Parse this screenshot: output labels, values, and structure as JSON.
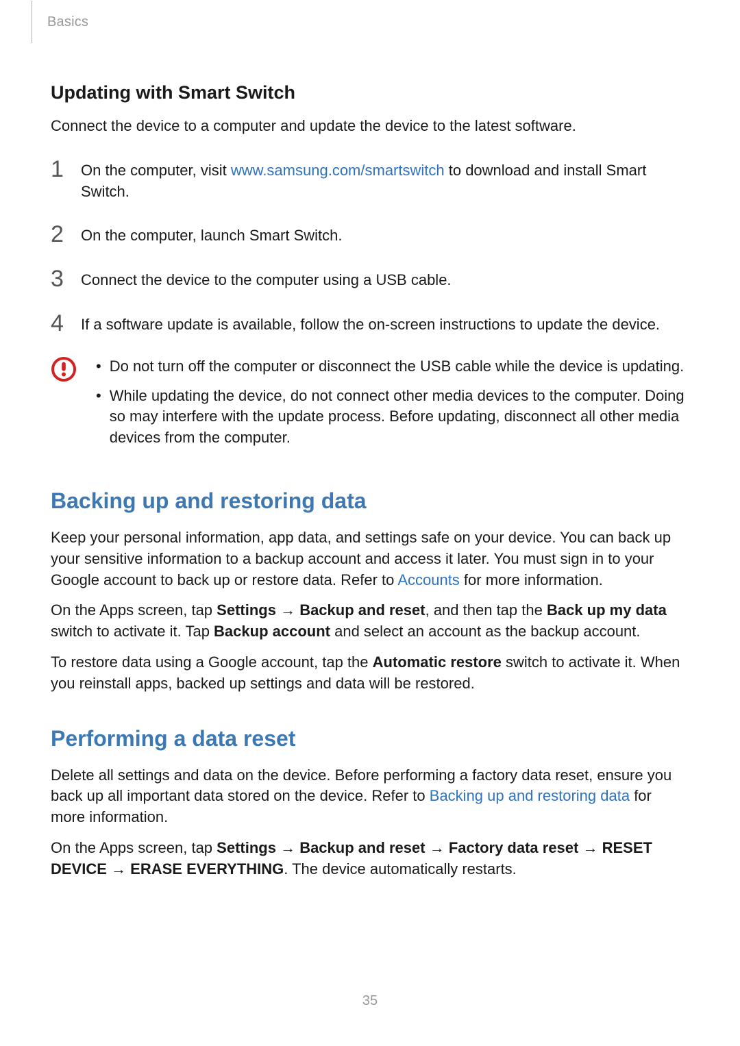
{
  "header": {
    "crumb": "Basics"
  },
  "section_update": {
    "title": "Updating with Smart Switch",
    "intro": "Connect the device to a computer and update the device to the latest software.",
    "steps": {
      "s1": {
        "num": "1",
        "pre": "On the computer, visit ",
        "link": "www.samsung.com/smartswitch",
        "post": " to download and install Smart Switch."
      },
      "s2": {
        "num": "2",
        "text": "On the computer, launch Smart Switch."
      },
      "s3": {
        "num": "3",
        "text": "Connect the device to the computer using a USB cable."
      },
      "s4": {
        "num": "4",
        "text": "If a software update is available, follow the on-screen instructions to update the device."
      }
    },
    "caution": {
      "b1": "Do not turn off the computer or disconnect the USB cable while the device is updating.",
      "b2": "While updating the device, do not connect other media devices to the computer. Doing so may interfere with the update process. Before updating, disconnect all other media devices from the computer."
    }
  },
  "section_backup": {
    "title": "Backing up and restoring data",
    "p1": {
      "pre": "Keep your personal information, app data, and settings safe on your device. You can back up your sensitive information to a backup account and access it later. You must sign in to your Google account to back up or restore data. Refer to ",
      "link": "Accounts",
      "post": " for more information."
    },
    "p2": {
      "arrow": "→",
      "text_a": "On the Apps screen, tap ",
      "b1": "Settings",
      "b2": "Backup and reset",
      "text_b": ", and then tap the ",
      "b3": "Back up my data",
      "text_c": " switch to activate it. Tap ",
      "b4": "Backup account",
      "text_d": " and select an account as the backup account."
    },
    "p3": {
      "text_a": "To restore data using a Google account, tap the ",
      "b1": "Automatic restore",
      "text_b": " switch to activate it. When you reinstall apps, backed up settings and data will be restored."
    }
  },
  "section_reset": {
    "title": "Performing a data reset",
    "p1": {
      "pre": "Delete all settings and data on the device. Before performing a factory data reset, ensure you back up all important data stored on the device. Refer to ",
      "link": "Backing up and restoring data",
      "post": " for more information."
    },
    "p2": {
      "arrow": "→",
      "text_a": "On the Apps screen, tap ",
      "b1": "Settings",
      "b2": "Backup and reset",
      "b3": "Factory data reset",
      "b4": "RESET DEVICE",
      "b5": "ERASE EVERYTHING",
      "text_b": ". The device automatically restarts."
    }
  },
  "footer": {
    "page_number": "35"
  },
  "icons": {
    "caution": "caution-icon"
  },
  "colors": {
    "heading_blue": "#3d78b2",
    "link_blue": "#2f72bf",
    "caution_red": "#d22222",
    "crumb_grey": "#999999"
  }
}
